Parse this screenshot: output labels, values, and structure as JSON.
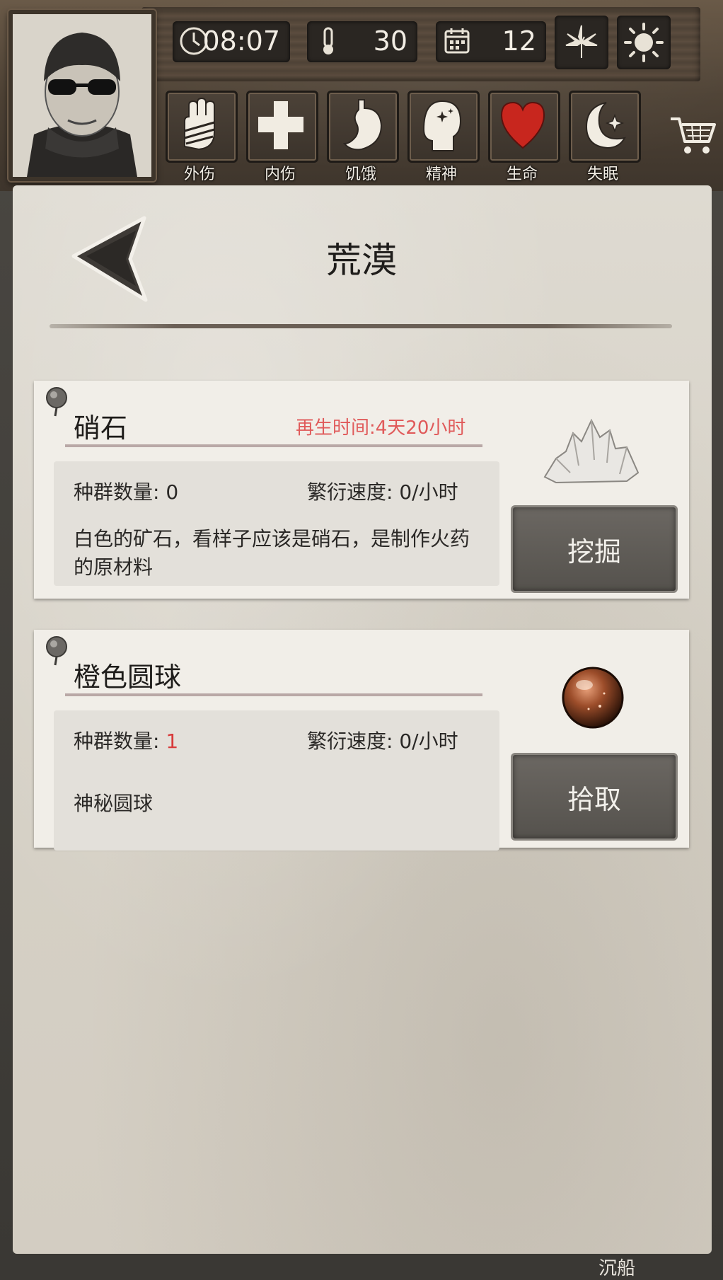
{
  "status": {
    "time": "08:07",
    "temperature": "30",
    "day": "12",
    "icons": [
      "clock-icon",
      "thermometer-icon",
      "calendar-icon",
      "leaf-icon",
      "sun-icon"
    ]
  },
  "stats": [
    {
      "label": "外伤",
      "icon": "bandaged-hand-icon"
    },
    {
      "label": "内伤",
      "icon": "cross-icon"
    },
    {
      "label": "饥饿",
      "icon": "stomach-icon"
    },
    {
      "label": "精神",
      "icon": "head-icon"
    },
    {
      "label": "生命",
      "icon": "heart-icon"
    },
    {
      "label": "失眠",
      "icon": "moon-icon"
    }
  ],
  "page": {
    "title": "荒漠"
  },
  "items": [
    {
      "name": "硝石",
      "regen": "再生时间:4天20小时",
      "population_label": "种群数量: ",
      "population_value": "0",
      "rate": "繁衍速度: 0/小时",
      "description": "白色的矿石，看样子应该是硝石，是制作火药的原材料",
      "action": "挖掘",
      "icon": "saltpeter-crystal-icon"
    },
    {
      "name": "橙色圆球",
      "regen": "",
      "population_label": "种群数量: ",
      "population_value": "1",
      "rate": "繁衍速度: 0/小时",
      "description": "神秘圆球",
      "action": "拾取",
      "icon": "orange-orb-icon"
    }
  ],
  "footer": {
    "partial_label": "沉船"
  },
  "colors": {
    "regen": "#e05a5a",
    "population_highlight": "#d83b3b",
    "heart": "#c8261e"
  }
}
